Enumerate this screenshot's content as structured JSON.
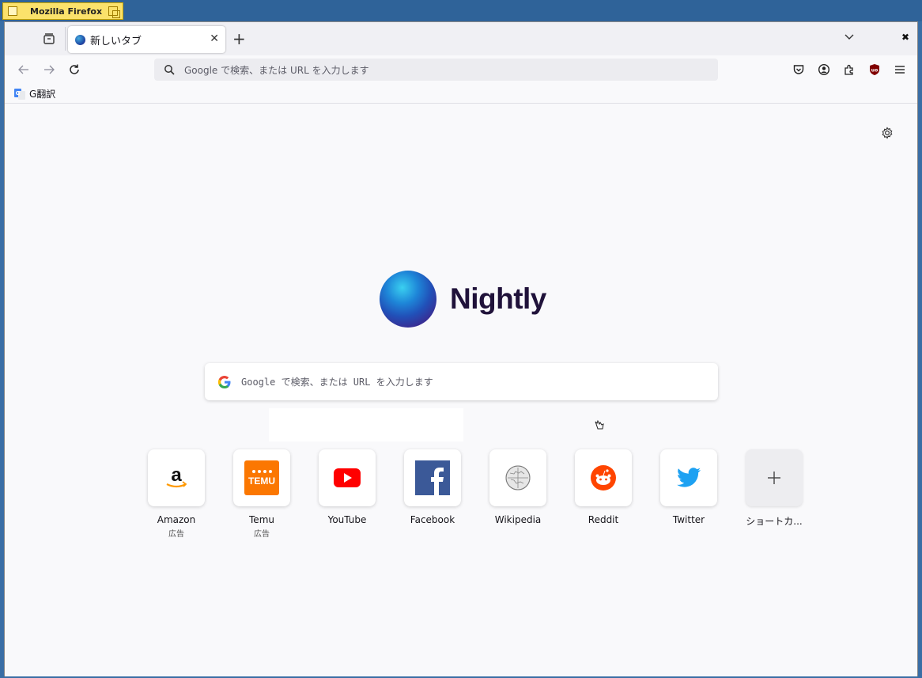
{
  "os": {
    "window_title": "Mozilla Firefox"
  },
  "tabs": [
    {
      "title": "新しいタブ"
    }
  ],
  "urlbar": {
    "placeholder": "Google で検索、または URL を入力します"
  },
  "bookmarks": [
    {
      "label": "G翻訳"
    }
  ],
  "newtab": {
    "brand": "Nightly",
    "search_placeholder": "Google で検索、または URL を入力します",
    "tiles": [
      {
        "label": "Amazon",
        "sub": "広告"
      },
      {
        "label": "Temu",
        "sub": "広告",
        "logo_text": "TEMU"
      },
      {
        "label": "YouTube",
        "sub": ""
      },
      {
        "label": "Facebook",
        "sub": ""
      },
      {
        "label": "Wikipedia",
        "sub": ""
      },
      {
        "label": "Reddit",
        "sub": ""
      },
      {
        "label": "Twitter",
        "sub": ""
      },
      {
        "label": "ショートカ...",
        "sub": ""
      }
    ]
  },
  "colors": {
    "amazon_orange": "#ff9900",
    "temu_orange": "#fb7701",
    "youtube_red": "#ff0000",
    "facebook_blue": "#3b5998",
    "reddit_orange": "#ff4500",
    "twitter_blue": "#1da1f2"
  }
}
